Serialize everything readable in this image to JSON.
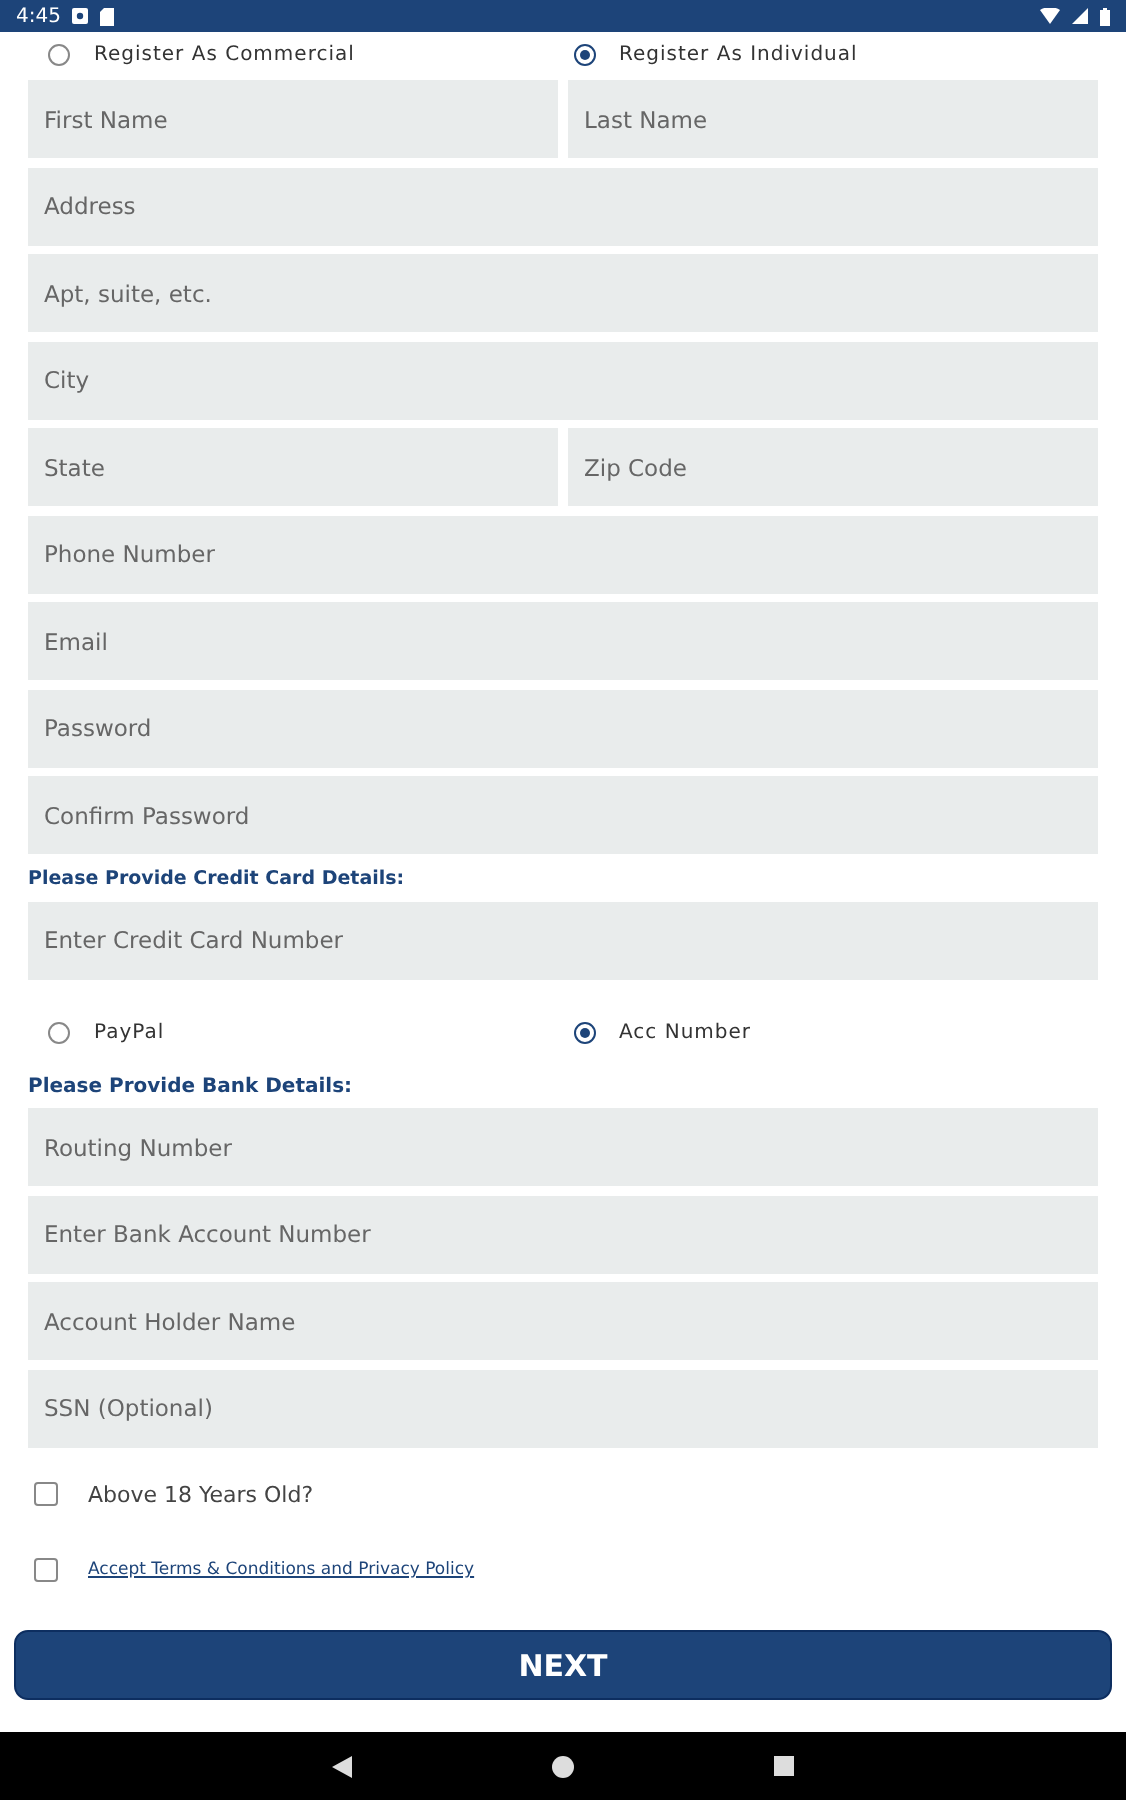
{
  "status_bar": {
    "time": "4:45"
  },
  "account_type": [
    {
      "label": "Register As Commercial",
      "selected": false
    },
    {
      "label": "Register As Individual",
      "selected": true
    }
  ],
  "personal_fields": [
    [
      {
        "placeholder": "First Name"
      },
      {
        "placeholder": "Last Name"
      }
    ],
    [
      {
        "placeholder": "Address"
      }
    ],
    [
      {
        "placeholder": "Apt, suite, etc."
      }
    ],
    [
      {
        "placeholder": "City"
      }
    ],
    [
      {
        "placeholder": "State"
      },
      {
        "placeholder": "Zip Code"
      }
    ],
    [
      {
        "placeholder": "Phone Number"
      }
    ],
    [
      {
        "placeholder": "Email"
      }
    ],
    [
      {
        "placeholder": "Password"
      }
    ],
    [
      {
        "placeholder": "Confirm Password"
      }
    ]
  ],
  "credit_card": {
    "heading": "Please Provide Credit Card Details:",
    "placeholder": "Enter Credit Card Number"
  },
  "payment_method": [
    {
      "label": "PayPal",
      "selected": false
    },
    {
      "label": "Acc Number",
      "selected": true
    }
  ],
  "bank": {
    "heading": "Please Provide Bank Details:",
    "fields": [
      {
        "placeholder": "Routing Number"
      },
      {
        "placeholder": "Enter Bank Account Number"
      },
      {
        "placeholder": "Account Holder Name"
      },
      {
        "placeholder": "SSN (Optional)"
      }
    ]
  },
  "checkboxes": [
    {
      "kind": "text",
      "label": "Above 18 Years Old?",
      "checked": false
    },
    {
      "kind": "link",
      "label": "Accept Terms & Conditions and Privacy Policy",
      "checked": false
    }
  ],
  "next_button": "NEXT"
}
